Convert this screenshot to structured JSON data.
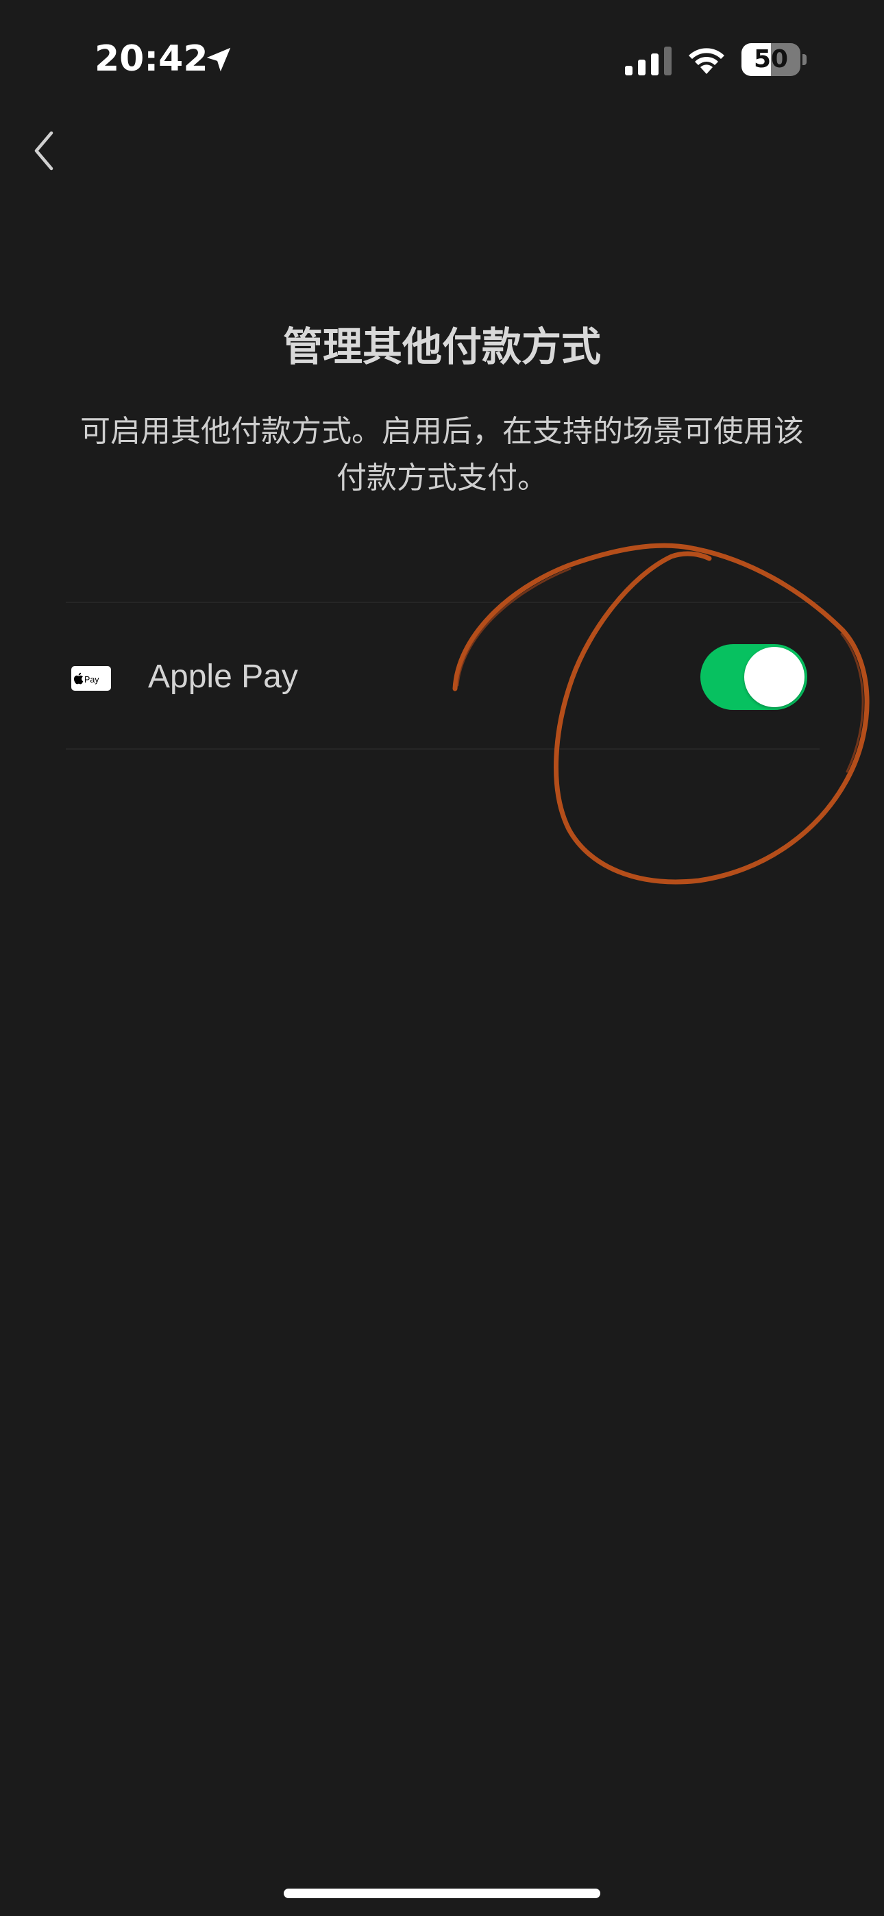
{
  "status_bar": {
    "time": "20:42",
    "battery_level": "50",
    "battery_fraction": 0.5,
    "icons": [
      "location-arrow-icon",
      "cellular-signal-icon",
      "wifi-icon",
      "battery-icon"
    ]
  },
  "nav": {
    "back_icon": "chevron-left-icon"
  },
  "page": {
    "title": "管理其他付款方式",
    "description": "可启用其他付款方式。启用后，在支持的场景可使用该付款方式支付。"
  },
  "payment_methods": [
    {
      "icon": "apple-pay-icon",
      "label": "Apple Pay",
      "enabled": true
    }
  ],
  "colors": {
    "background": "#1b1b1b",
    "toggle_on": "#07c160",
    "annotation": "#c2521a"
  }
}
